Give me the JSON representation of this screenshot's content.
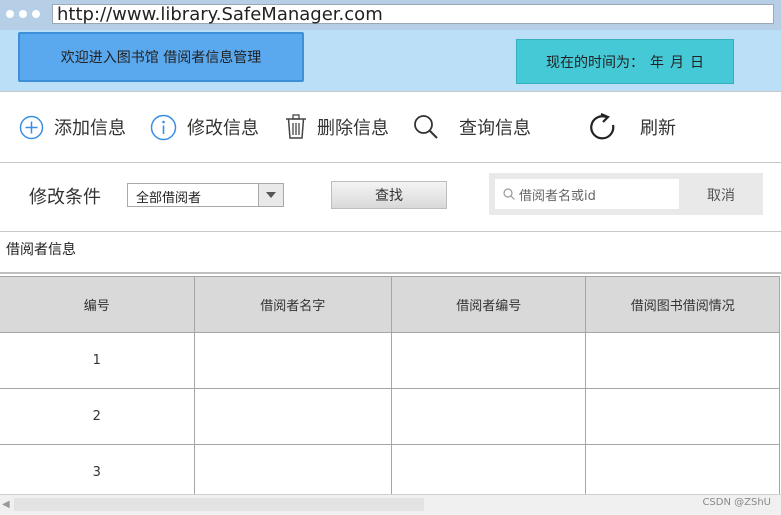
{
  "browser": {
    "url": "http://www.library.SafeManager.com"
  },
  "header": {
    "welcome": "欢迎进入图书馆  借阅者信息管理",
    "time_label": "现在的时间为：",
    "time_year": "年",
    "time_month": "月",
    "time_day": "日"
  },
  "toolbar": {
    "add": "添加信息",
    "edit": "修改信息",
    "delete": "删除信息",
    "query": "查询信息",
    "refresh": "刷新"
  },
  "filter": {
    "label": "修改条件",
    "select_value": "全部借阅者",
    "find_button": "查找",
    "search_placeholder": "借阅者名或id",
    "cancel": "取消"
  },
  "section_title": "借阅者信息",
  "table": {
    "headers": [
      "编号",
      "借阅者名字",
      "借阅者编号",
      "借阅图书借阅情况"
    ],
    "rows": [
      [
        "1",
        "",
        "",
        ""
      ],
      [
        "2",
        "",
        "",
        ""
      ],
      [
        "3",
        "",
        "",
        ""
      ]
    ]
  },
  "watermark": "CSDN @ZShU"
}
